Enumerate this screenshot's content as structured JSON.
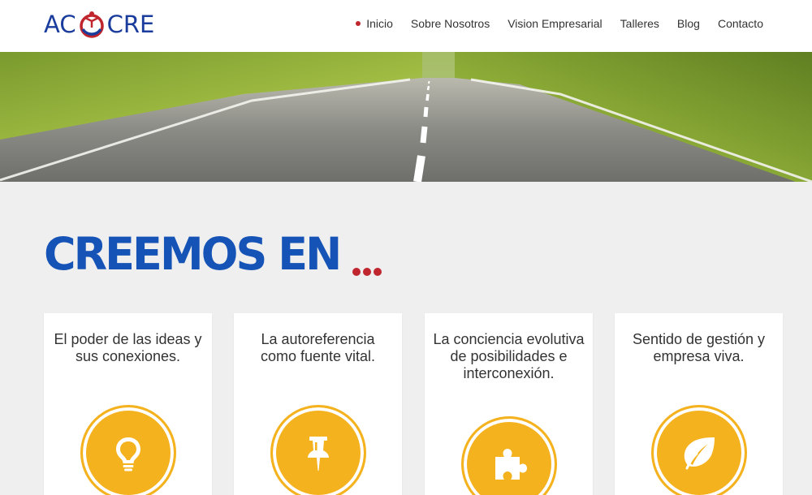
{
  "header": {
    "logo": {
      "left": "AC",
      "right": "CRE"
    },
    "nav": [
      {
        "label": "Inicio",
        "active": true
      },
      {
        "label": "Sobre Nosotros",
        "active": false
      },
      {
        "label": "Vision Empresarial",
        "active": false
      },
      {
        "label": "Talleres",
        "active": false
      },
      {
        "label": "Blog",
        "active": false
      },
      {
        "label": "Contacto",
        "active": false
      }
    ]
  },
  "hero": {
    "image": "road-through-forest"
  },
  "main": {
    "headline": "CREEMOS EN",
    "cards": [
      {
        "title": "El poder de las ideas y sus conexiones.",
        "icon": "lightbulb-icon"
      },
      {
        "title": "La autoreferencia como fuente vital.",
        "icon": "pushpin-icon"
      },
      {
        "title": "La conciencia evolutiva de posibilidades e interconexión.",
        "icon": "puzzle-piece-icon"
      },
      {
        "title": "Sentido de gestión y empresa viva.",
        "icon": "leaf-icon"
      }
    ]
  },
  "colors": {
    "brand_blue": "#1553b6",
    "accent_red": "#c0262d",
    "icon_yellow": "#f5b21f"
  }
}
